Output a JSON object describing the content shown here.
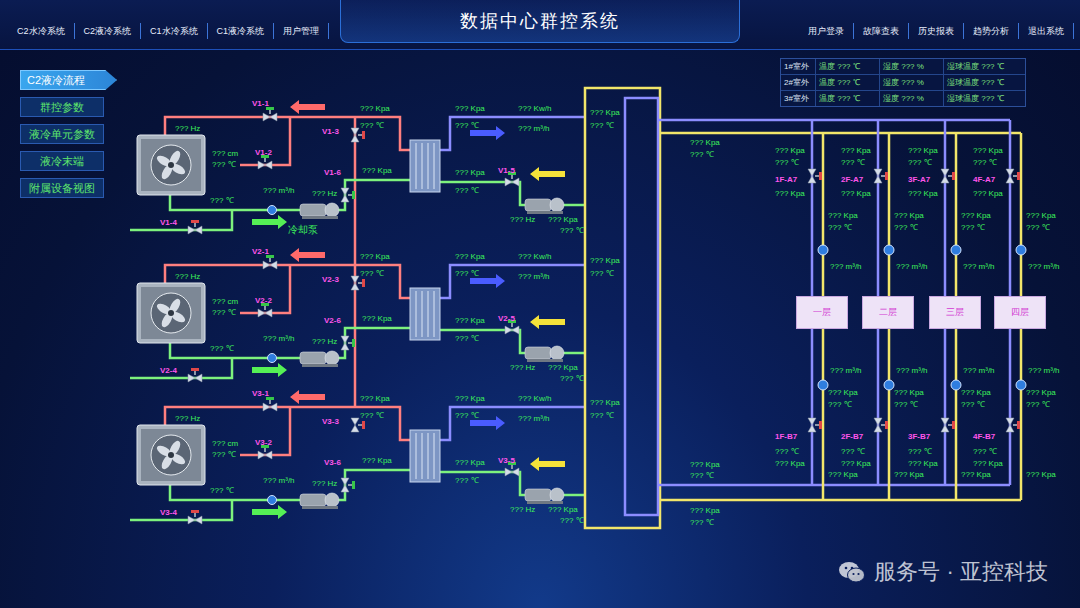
{
  "header": {
    "title": "数据中心群控系统",
    "left_nav": [
      "C2水冷系统",
      "C2液冷系统",
      "C1水冷系统",
      "C1液冷系统",
      "用户管理"
    ],
    "right_nav": [
      "用户登录",
      "故障查表",
      "历史报表",
      "趋势分析",
      "退出系统"
    ]
  },
  "sidebar": {
    "items": [
      {
        "label": "C2液冷流程",
        "selected": true
      },
      {
        "label": "群控参数",
        "selected": false
      },
      {
        "label": "液冷单元参数",
        "selected": false
      },
      {
        "label": "液冷末端",
        "selected": false
      },
      {
        "label": "附属设备视图",
        "selected": false
      }
    ]
  },
  "weather": {
    "rows": [
      {
        "cells": [
          "1#室外",
          "温度 ??? ℃",
          "湿度 ??? %",
          "湿球温度 ??? ℃"
        ]
      },
      {
        "cells": [
          "2#室外",
          "温度 ??? ℃",
          "湿度 ??? %",
          "湿球温度 ??? ℃"
        ]
      },
      {
        "cells": [
          "3#室外",
          "温度 ??? ℃",
          "湿度 ??? %",
          "湿球温度 ??? ℃"
        ]
      }
    ]
  },
  "diagram": {
    "pump_label": "冷却泵",
    "units": [
      {
        "labels": [
          {
            "text": "V1-1",
            "kind": "valve",
            "open": true
          },
          {
            "text": "??? Hz",
            "kind": "reading"
          },
          {
            "text": "V1-2",
            "kind": "valve",
            "open": true
          },
          {
            "text": "??? cm",
            "kind": "reading"
          },
          {
            "text": "??? ℃",
            "kind": "reading"
          },
          {
            "text": "??? m³/h",
            "kind": "reading"
          },
          {
            "text": "??? ℃",
            "kind": "reading"
          },
          {
            "text": "V1-4",
            "kind": "valve",
            "open": false
          },
          {
            "text": "V1-3",
            "kind": "valve",
            "open": false
          },
          {
            "text": "??? Kpa",
            "kind": "reading"
          },
          {
            "text": "??? ℃",
            "kind": "reading"
          },
          {
            "text": "V1-6",
            "kind": "valve",
            "open": true
          },
          {
            "text": "??? Kpa",
            "kind": "reading"
          },
          {
            "text": "??? Hz",
            "kind": "reading"
          },
          {
            "text": "??? Kpa",
            "kind": "reading"
          },
          {
            "text": "??? Kw/h",
            "kind": "reading"
          },
          {
            "text": "??? m³/h",
            "kind": "reading"
          },
          {
            "text": "??? ℃",
            "kind": "reading"
          },
          {
            "text": "??? Kpa",
            "kind": "reading"
          },
          {
            "text": "??? ℃",
            "kind": "reading"
          },
          {
            "text": "V1-5",
            "kind": "valve",
            "open": true
          },
          {
            "text": "??? Hz",
            "kind": "reading"
          },
          {
            "text": "??? Kpa",
            "kind": "reading"
          },
          {
            "text": "??? ℃",
            "kind": "reading"
          },
          {
            "text": "??? Kpa",
            "kind": "reading"
          },
          {
            "text": "??? ℃",
            "kind": "reading"
          }
        ]
      },
      {
        "labels": [
          {
            "text": "V2-1",
            "kind": "valve",
            "open": true
          },
          {
            "text": "??? Hz",
            "kind": "reading"
          },
          {
            "text": "V2-2",
            "kind": "valve",
            "open": true
          },
          {
            "text": "??? cm",
            "kind": "reading"
          },
          {
            "text": "??? ℃",
            "kind": "reading"
          },
          {
            "text": "??? m³/h",
            "kind": "reading"
          },
          {
            "text": "??? ℃",
            "kind": "reading"
          },
          {
            "text": "V2-4",
            "kind": "valve",
            "open": false
          },
          {
            "text": "V2-3",
            "kind": "valve",
            "open": false
          },
          {
            "text": "??? Kpa",
            "kind": "reading"
          },
          {
            "text": "??? ℃",
            "kind": "reading"
          },
          {
            "text": "V2-6",
            "kind": "valve",
            "open": true
          },
          {
            "text": "??? Kpa",
            "kind": "reading"
          },
          {
            "text": "??? Hz",
            "kind": "reading"
          },
          {
            "text": "??? Kpa",
            "kind": "reading"
          },
          {
            "text": "??? Kw/h",
            "kind": "reading"
          },
          {
            "text": "??? m³/h",
            "kind": "reading"
          },
          {
            "text": "??? ℃",
            "kind": "reading"
          },
          {
            "text": "??? Kpa",
            "kind": "reading"
          },
          {
            "text": "??? ℃",
            "kind": "reading"
          },
          {
            "text": "V2-5",
            "kind": "valve",
            "open": true
          },
          {
            "text": "??? Hz",
            "kind": "reading"
          },
          {
            "text": "??? Kpa",
            "kind": "reading"
          },
          {
            "text": "??? ℃",
            "kind": "reading"
          },
          {
            "text": "??? Kpa",
            "kind": "reading"
          },
          {
            "text": "??? ℃",
            "kind": "reading"
          }
        ]
      },
      {
        "labels": [
          {
            "text": "V3-1",
            "kind": "valve",
            "open": true
          },
          {
            "text": "??? Hz",
            "kind": "reading"
          },
          {
            "text": "V3-2",
            "kind": "valve",
            "open": true
          },
          {
            "text": "??? cm",
            "kind": "reading"
          },
          {
            "text": "??? ℃",
            "kind": "reading"
          },
          {
            "text": "??? m³/h",
            "kind": "reading"
          },
          {
            "text": "??? ℃",
            "kind": "reading"
          },
          {
            "text": "V3-4",
            "kind": "valve",
            "open": false
          },
          {
            "text": "V3-3",
            "kind": "valve",
            "open": false
          },
          {
            "text": "??? Kpa",
            "kind": "reading"
          },
          {
            "text": "??? ℃",
            "kind": "reading"
          },
          {
            "text": "V3-6",
            "kind": "valve",
            "open": true
          },
          {
            "text": "??? Kpa",
            "kind": "reading"
          },
          {
            "text": "??? Hz",
            "kind": "reading"
          },
          {
            "text": "??? Kpa",
            "kind": "reading"
          },
          {
            "text": "??? Kw/h",
            "kind": "reading"
          },
          {
            "text": "??? m³/h",
            "kind": "reading"
          },
          {
            "text": "??? ℃",
            "kind": "reading"
          },
          {
            "text": "??? Kpa",
            "kind": "reading"
          },
          {
            "text": "??? ℃",
            "kind": "reading"
          },
          {
            "text": "V3-5",
            "kind": "valve",
            "open": true
          },
          {
            "text": "??? Hz",
            "kind": "reading"
          },
          {
            "text": "??? Kpa",
            "kind": "reading"
          },
          {
            "text": "??? ℃",
            "kind": "reading"
          },
          {
            "text": "??? Kpa",
            "kind": "reading"
          },
          {
            "text": "??? ℃",
            "kind": "reading"
          }
        ]
      }
    ],
    "manifold_labels": [
      "??? Kpa",
      "??? ℃",
      "??? Kpa",
      "??? ℃",
      "??? Kpa",
      "??? ℃"
    ],
    "floors": [
      {
        "name": "一层",
        "valve_a": {
          "text": "1F-A7",
          "open": false
        },
        "valve_b": {
          "text": "1F-B7",
          "open": false
        },
        "labels": [
          "??? Kpa",
          "??? ℃",
          "??? Kpa",
          "??? Kpa",
          "??? ℃",
          "??? m³/h",
          "??? m³/h",
          "??? Kpa",
          "??? ℃",
          "??? ℃",
          "??? Kpa",
          "??? Kpa"
        ]
      },
      {
        "name": "二层",
        "valve_a": {
          "text": "2F-A7",
          "open": false
        },
        "valve_b": {
          "text": "2F-B7",
          "open": false
        },
        "labels": [
          "??? Kpa",
          "??? ℃",
          "??? Kpa",
          "??? Kpa",
          "??? ℃",
          "??? m³/h",
          "??? m³/h",
          "??? Kpa",
          "??? ℃",
          "??? ℃",
          "??? Kpa",
          "??? Kpa"
        ]
      },
      {
        "name": "三层",
        "valve_a": {
          "text": "3F-A7",
          "open": false
        },
        "valve_b": {
          "text": "3F-B7",
          "open": false
        },
        "labels": [
          "??? Kpa",
          "??? ℃",
          "??? Kpa",
          "??? Kpa",
          "??? ℃",
          "??? m³/h",
          "??? m³/h",
          "??? Kpa",
          "??? ℃",
          "??? ℃",
          "??? Kpa",
          "??? Kpa"
        ]
      },
      {
        "name": "四层",
        "valve_a": {
          "text": "4F-A7",
          "open": false
        },
        "valve_b": {
          "text": "4F-B7",
          "open": false
        },
        "labels": [
          "??? Kpa",
          "??? ℃",
          "??? Kpa",
          "??? Kpa",
          "??? ℃",
          "??? m³/h",
          "??? m³/h",
          "??? Kpa",
          "??? ℃",
          "??? ℃",
          "??? Kpa",
          "??? Kpa"
        ]
      }
    ]
  },
  "watermark": "服务号 · 亚控科技"
}
